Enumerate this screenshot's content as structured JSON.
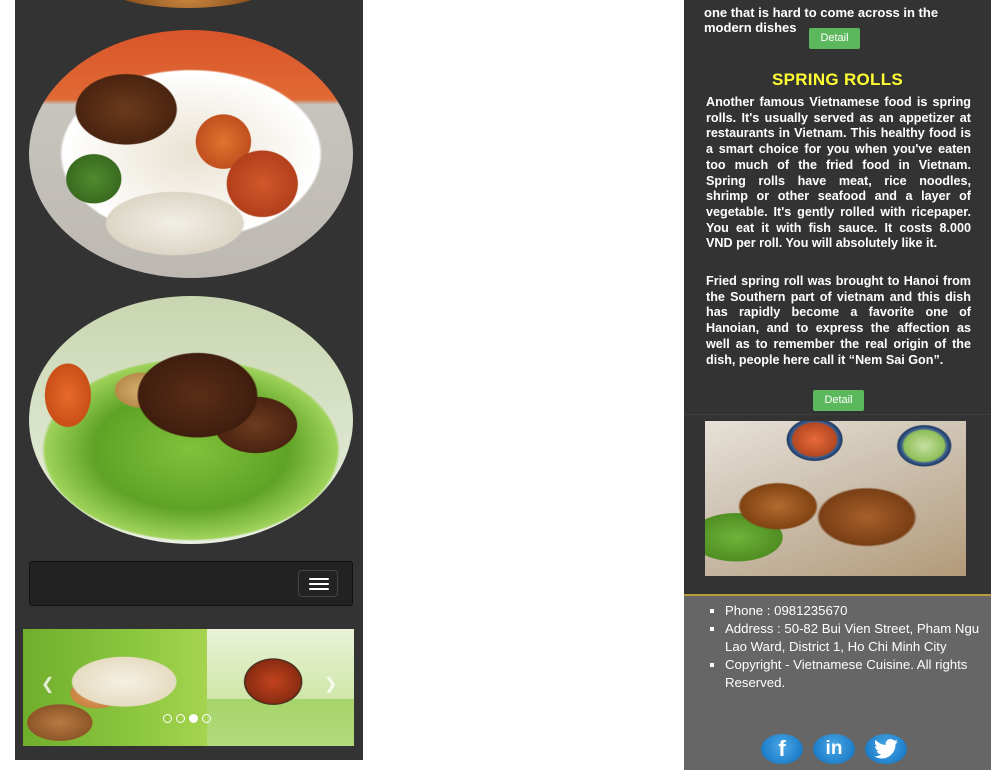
{
  "right": {
    "previous_text": "one that is hard to come across in the modern dishes",
    "detail_label": "Detail",
    "section_title": "SPRING ROLLS",
    "paragraph_1": "Another famous Vietnamese food is spring rolls. It's usually served as an appetizer at restaurants in Vietnam. This healthy food is a smart choice for you when you've eaten too much of the fried food in Vietnam. Spring rolls have meat, rice noodles, shrimp or other seafood and a layer of vegetable. It's gently rolled with ricepaper. You eat it with fish sauce. It costs 8.000 VND per roll. You will absolutely like it.",
    "paragraph_2": "Fried spring roll was brought to Hanoi from the Southern part of vietnam and this dish has rapidly become a favorite one of Hanoian, and to express the affection as well as to remember the real origin of the dish, people here call it “Nem Sai Gon”.",
    "footer": {
      "phone": "Phone : 0981235670",
      "address": "Address : 50-82 Bui Vien Street, Pham Ngu Lao Ward, District 1, Ho Chi Minh City",
      "copyright": "Copyright - Vietnamese Cuisine. All rights Reserved."
    },
    "social": [
      {
        "label": "f",
        "icon": "facebook-icon"
      },
      {
        "label": "in",
        "icon": "linkedin-icon"
      },
      {
        "label": "",
        "icon": "twitter-icon"
      }
    ]
  },
  "left": {
    "slider": {
      "dot_count": 4,
      "active_dot": 3
    }
  },
  "colors": {
    "panel_bg": "#333333",
    "title_yellow": "#ffff33",
    "button_green": "#5cb85c",
    "footer_bg": "#666666",
    "social_blue": "#1f7fc9"
  }
}
